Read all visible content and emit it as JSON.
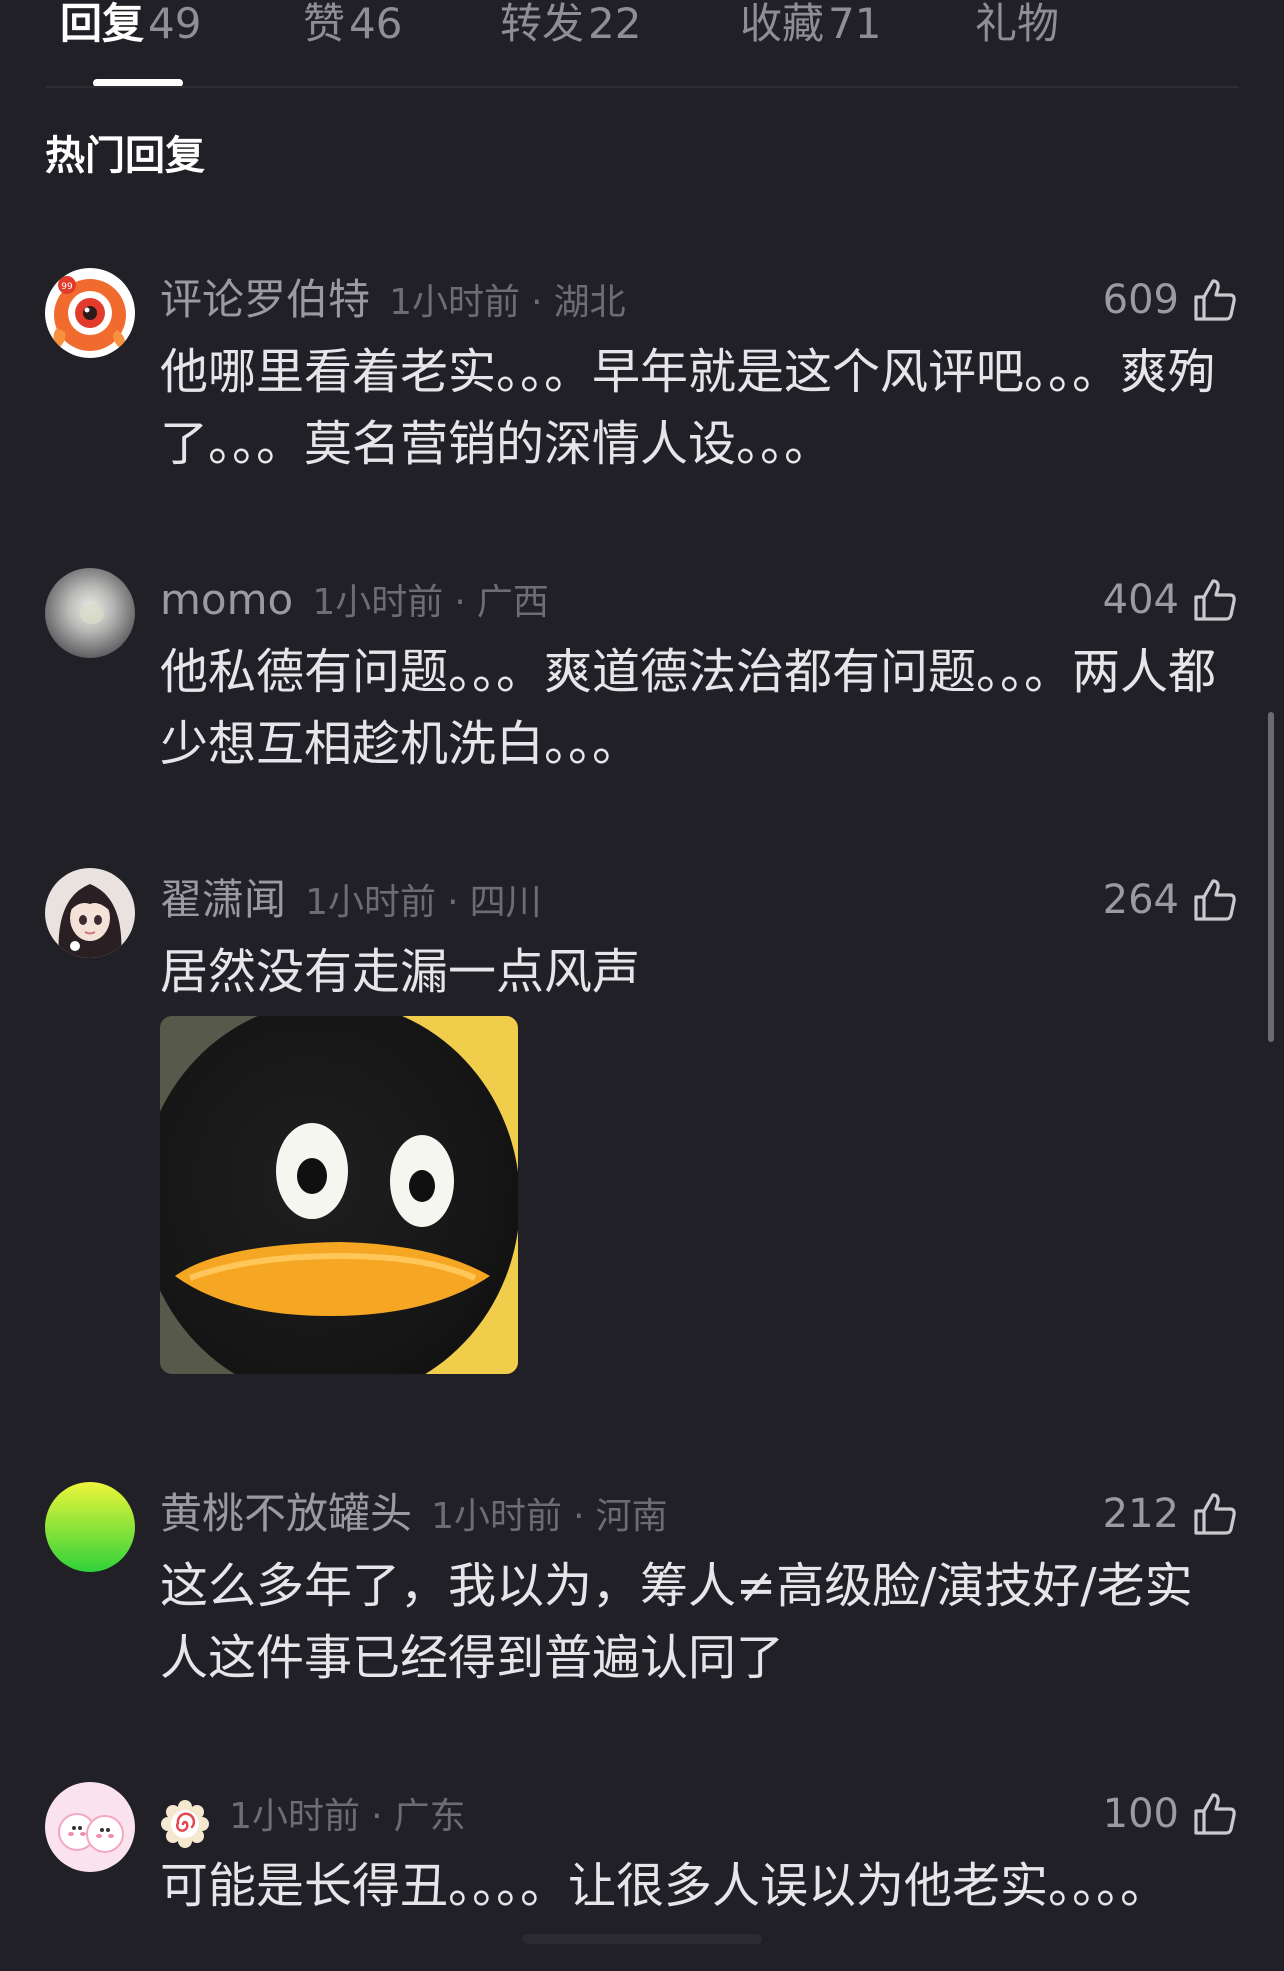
{
  "tabs": [
    {
      "label": "回复",
      "count": "49"
    },
    {
      "label": "赞",
      "count": "46"
    },
    {
      "label": "转发",
      "count": "22"
    },
    {
      "label": "收藏",
      "count": "71"
    },
    {
      "label": "礼物",
      "count": ""
    }
  ],
  "section_title": "热门回复",
  "comments": [
    {
      "name": "评论罗伯特",
      "time": "1小时前",
      "separator": "·",
      "location": "湖北",
      "likes": "609",
      "text": "他哪里看着老实。。。早年就是这个风评吧。。。爽殉了。。。莫名营销的深情人设。。。",
      "avatar_icon": "orange-fish-avatar"
    },
    {
      "name": "momo",
      "time": "1小时前",
      "separator": "·",
      "location": "广西",
      "likes": "404",
      "text": "他私德有问题。。。爽道德法治都有问题。。。两人都少想互相趁机洗白。。。",
      "avatar_icon": "gray-pearl-avatar"
    },
    {
      "name": "翟潇闻",
      "time": "1小时前",
      "separator": "·",
      "location": "四川",
      "likes": "264",
      "text": "居然没有走漏一点风声",
      "avatar_icon": "anime-girl-avatar",
      "sticker_icon": "penguin-face-sticker"
    },
    {
      "name": "黄桃不放罐头",
      "time": "1小时前",
      "separator": "·",
      "location": "河南",
      "likes": "212",
      "text": "这么多年了，我以为，筹人≠高级脸/演技好/老实人这件事已经得到普遍认同了",
      "avatar_icon": "green-gradient-avatar"
    },
    {
      "name": "",
      "time": "1小时前",
      "separator": "·",
      "location": "广东",
      "likes": "100",
      "text": "可能是长得丑。。。。让很多人误以为他老实。。。。",
      "avatar_icon": "pink-bunnies-avatar",
      "name_icon": "red-swirl-flower-emoji"
    }
  ],
  "colors": {
    "background": "#202026",
    "text_primary": "#e6e6ea",
    "text_secondary": "#9a9aa1",
    "text_muted": "#6c6c73",
    "active_tab": "#ffffff"
  }
}
